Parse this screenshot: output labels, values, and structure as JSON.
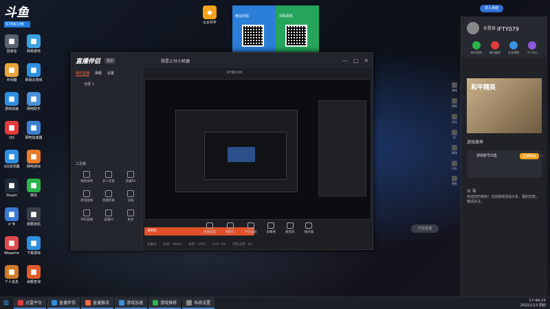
{
  "desktop": {
    "watermark": "斗鱼",
    "watermark_id": "9796108",
    "icons_col1": [
      "回收站",
      "中间键",
      "游戏加速",
      "QQ",
      "QQ浏览器",
      "Steam",
      "cf 专",
      "Wegame",
      "个人信息"
    ],
    "icons_col2": [
      "网易游戏",
      "网易云游戏",
      "网吧助手",
      "网吧加速器",
      "网吧游戏",
      "微信",
      "我要挂机",
      "下载游戏",
      "余额查询"
    ],
    "center_icon_label": "以太坊手",
    "qr_left_caption": "微信扫码",
    "qr_right_caption": "扫码领奖"
  },
  "app": {
    "logo": "直播伴侣",
    "badge": "模型",
    "tabs": [
      "我的直播",
      "弹幕",
      "设置"
    ],
    "scene_label": "全屏 1",
    "tools_label": "工具箱",
    "tools": [
      "视频录制",
      "多人连麦",
      "直播PK",
      "游戏直播",
      "直播装备",
      "设备",
      "手机直播",
      "直播间",
      "更多"
    ],
    "title": "我是上分小机器",
    "room_id": "9796108",
    "notice": "请修改"
  },
  "toolbar": [
    "直播画面",
    "摄像头",
    "手机投屏",
    "多媒体",
    "麦克风",
    "扬声器"
  ],
  "start_live": "开始直播",
  "statusbar": [
    "云推流",
    "码率：0KB/S",
    "帧率：0FPS",
    "CPU: 9%",
    "内存占用：0%"
  ],
  "game_panel": {
    "user": "未登录",
    "header_id": "IFTY079",
    "promo": "登录送福利、观看与网游直播领奖励",
    "shortcuts": [
      "每日签到",
      "每日福利",
      "礼包领取",
      "个人中心"
    ],
    "banner_title": "和平精英",
    "section": "游戏推荐",
    "section_more": "更多",
    "ad_title": "游戏账号出售",
    "ad_button": "立即购买",
    "welcome_title": "公 告",
    "welcome_text": "欢迎您的使用！当前游戏活动众多，福利无数，敬请关注。"
  },
  "sidebar": [
    "游戏",
    "网吧",
    "论坛",
    "CF",
    "网游",
    "LOL",
    "更多"
  ],
  "top_button": "进入桌面",
  "taskbar": {
    "items": [
      "迅雷平台",
      "直播伴侣",
      "直播推流",
      "游戏加速",
      "游戏推荐",
      "系统设置"
    ],
    "time": "17:44:15",
    "date": "2022/1/13 周四"
  },
  "colors": {
    "accent": "#ff6a3d",
    "blue": "#2f6fd6"
  }
}
